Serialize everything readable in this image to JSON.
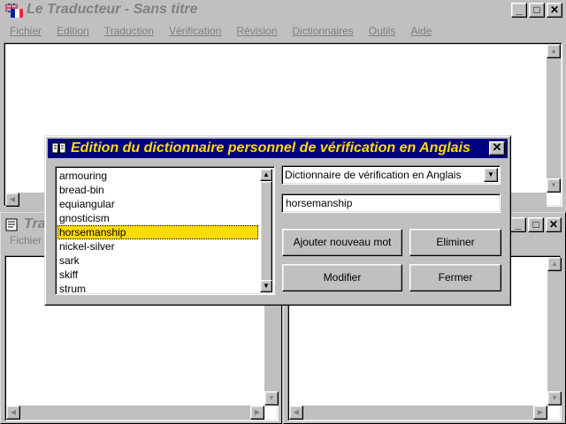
{
  "app": {
    "title": "Le Traducteur - Sans titre",
    "menu": [
      "Fichier",
      "Edition",
      "Traduction",
      "Vérification",
      "Révision",
      "Dictionnaires",
      "Outils",
      "Aide"
    ],
    "caption": {
      "minimize": "_",
      "maximize": "□",
      "close": "✕"
    }
  },
  "child_windows": {
    "left_title": "Tra",
    "left_menu": "Fichier"
  },
  "dialog": {
    "title": "Edition du dictionnaire personnel de vérification en Anglais",
    "close": "✕",
    "words": [
      "armouring",
      "bread-bin",
      "equiangular",
      "gnosticism",
      "horsemanship",
      "nickel-silver",
      "sark",
      "skiff",
      "strum"
    ],
    "selected_index": 4,
    "dictionary_select": "Dictionnaire de vérification en Anglais",
    "word_value": "horsemanship",
    "buttons": {
      "add": "Ajouter nouveau mot",
      "remove": "Eliminer",
      "modify": "Modifier",
      "close": "Fermer"
    }
  },
  "colors": {
    "dialog_title_bg": "#000080",
    "dialog_title_fg": "#ffdc00",
    "selection": "#ffdc00"
  }
}
